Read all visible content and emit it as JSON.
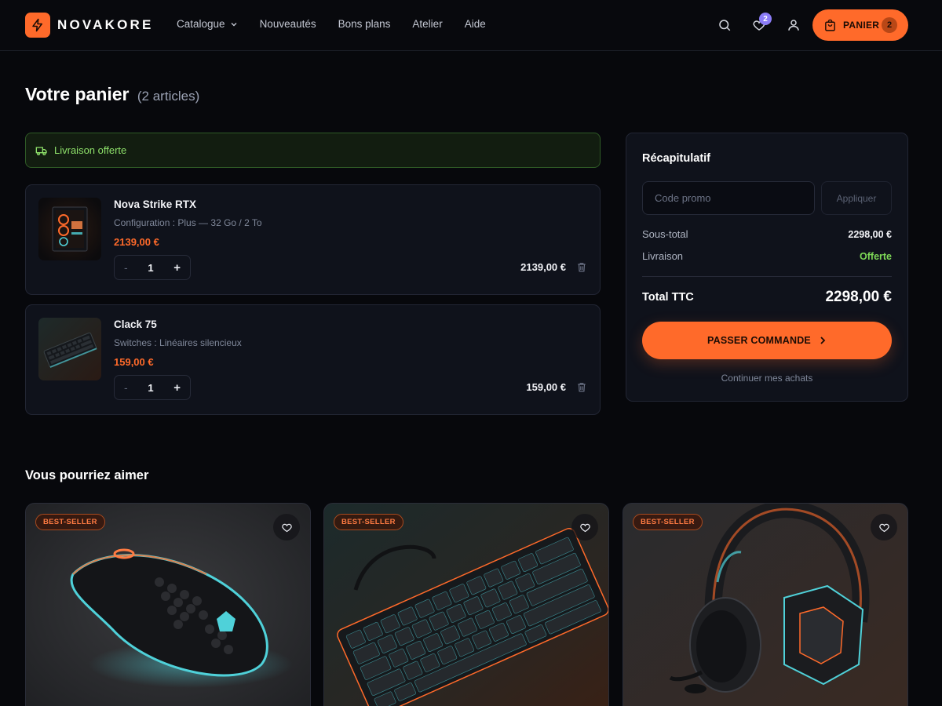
{
  "brand": {
    "name": "NOVAKORE"
  },
  "nav": {
    "catalogue": "Catalogue",
    "nouveautes": "Nouveautés",
    "bons_plans": "Bons plans",
    "atelier": "Atelier",
    "aide": "Aide"
  },
  "header": {
    "wishlist_count": "2",
    "cart_label": "PANIER",
    "cart_count": "2",
    "icons": [
      "search-icon",
      "heart-icon",
      "user-icon",
      "bag-icon"
    ]
  },
  "page": {
    "title": "Votre panier",
    "article_count": "(2 articles)"
  },
  "banner": {
    "text": "Livraison offerte"
  },
  "cart_items": [
    {
      "name": "Nova Strike RTX",
      "option": "Configuration : Plus — 32 Go / 2 To",
      "unit_price": "2139,00 €",
      "quantity": "1",
      "line_total": "2139,00 €",
      "minus": "-",
      "plus": "+"
    },
    {
      "name": "Clack 75",
      "option": "Switches : Linéaires silencieux",
      "unit_price": "159,00 €",
      "quantity": "1",
      "line_total": "159,00 €",
      "minus": "-",
      "plus": "+"
    }
  ],
  "summary": {
    "title": "Récapitulatif",
    "promo_placeholder": "Code promo",
    "promo_button": "Appliquer",
    "subtotal_label": "Sous-total",
    "subtotal_value": "2298,00 €",
    "shipping_label": "Livraison",
    "shipping_value": "Offerte",
    "total_label": "Total TTC",
    "total_value": "2298,00 €",
    "checkout_label": "PASSER COMMANDE",
    "continue_label": "Continuer mes achats"
  },
  "recommendations": {
    "title": "Vous pourriez aimer",
    "products": [
      {
        "badge": "BEST-SELLER",
        "image": "gaming-mouse"
      },
      {
        "badge": "BEST-SELLER",
        "image": "mechanical-keyboard"
      },
      {
        "badge": "BEST-SELLER",
        "image": "gaming-headset"
      }
    ]
  },
  "colors": {
    "accent": "#ff6a2a",
    "background": "#07080c",
    "panel": "#0f121b",
    "success": "#7ed957",
    "badge": "#8b7cf6"
  }
}
